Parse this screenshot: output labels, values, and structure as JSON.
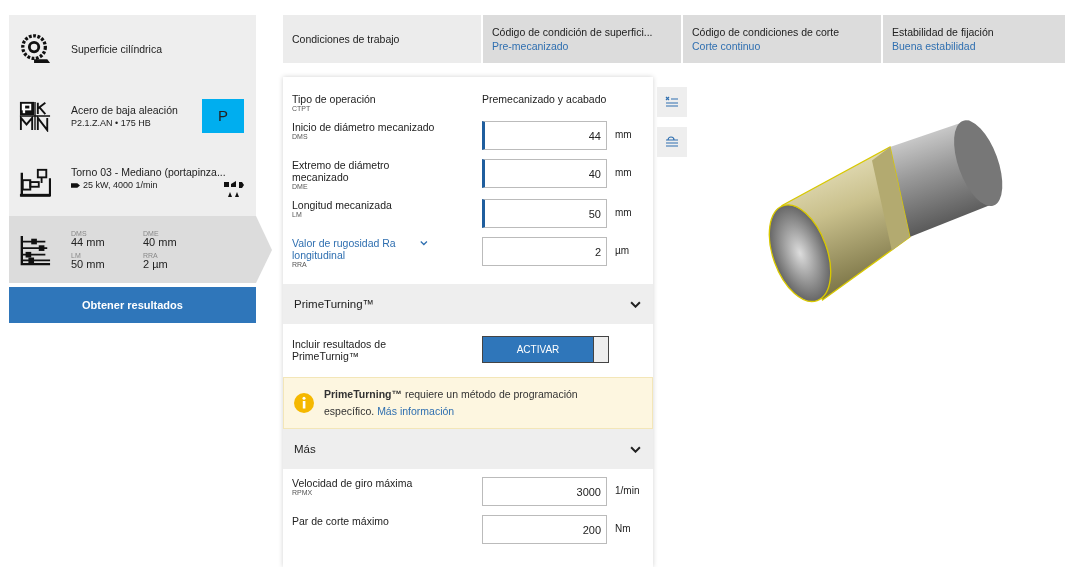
{
  "sidebar": {
    "steps": [
      {
        "kind": "surface",
        "title": "Superficie cilíndrica",
        "selected": false
      },
      {
        "kind": "material",
        "title": "Acero de baja aleación",
        "subtitle": "P2.1.Z.AN • 175 HB",
        "badge": "P",
        "color": "#00aeef",
        "selected": false
      },
      {
        "kind": "machine",
        "title": "Torno 03 - Mediano (portapinza...",
        "subtitle": "25 kW, 4000 1/min",
        "selected": false
      },
      {
        "kind": "conditions",
        "selected": true,
        "values": [
          {
            "code": "DMS",
            "value": "44 mm"
          },
          {
            "code": "DME",
            "value": "40 mm"
          },
          {
            "code": "LM",
            "value": "50 mm"
          },
          {
            "code": "RRA",
            "value": "2 µm"
          }
        ]
      }
    ],
    "button": "Obtener resultados"
  },
  "tabs": [
    {
      "label": "Condiciones de trabajo",
      "selected": true
    },
    {
      "label": "Código de condición de superfici...",
      "value": "Pre-mecanizado",
      "selected": false
    },
    {
      "label": "Código de condiciones de corte",
      "value": "Corte continuo",
      "selected": false
    },
    {
      "label": "Estabilidad de fijación",
      "value": "Buena estabilidad",
      "selected": false
    }
  ],
  "form": {
    "fields": [
      {
        "kind": "text",
        "label": "Tipo de operación",
        "code": "CTPT",
        "value": "Premecanizado y acabado"
      },
      {
        "kind": "input",
        "label": "Inicio de diámetro mecanizado",
        "code": "DMS",
        "value": "44",
        "unit": "mm",
        "marked": true
      },
      {
        "kind": "input",
        "label": "Extremo de diámetro mecanizado",
        "code": "DME",
        "value": "40",
        "unit": "mm",
        "marked": true
      },
      {
        "kind": "input",
        "label": "Longitud mecanizada",
        "code": "LM",
        "value": "50",
        "unit": "mm",
        "marked": true
      },
      {
        "kind": "dropdown",
        "label": "Valor de rugosidad Ra longitudinal",
        "code": "RRA",
        "value": "2",
        "unit": "µm",
        "marked": false
      }
    ],
    "sections": [
      {
        "title": "PrimeTurning™",
        "expanded": true,
        "toggle": {
          "label": "Incluir resultados de PrimeTurnig™",
          "button": "ACTIVAR",
          "on": true
        },
        "notice": {
          "text": "**PrimeTurning™** requiere un método de programación específico.",
          "link": "Más información"
        }
      },
      {
        "title": "Más",
        "expanded": true,
        "fields": [
          {
            "kind": "input",
            "label": "Velocidad de giro máxima",
            "code": "RPMX",
            "value": "3000",
            "unit": "1/min",
            "marked": false
          },
          {
            "kind": "input",
            "label": "Par de corte máximo",
            "value": "200",
            "unit": "Nm",
            "marked": false
          }
        ]
      }
    ]
  }
}
